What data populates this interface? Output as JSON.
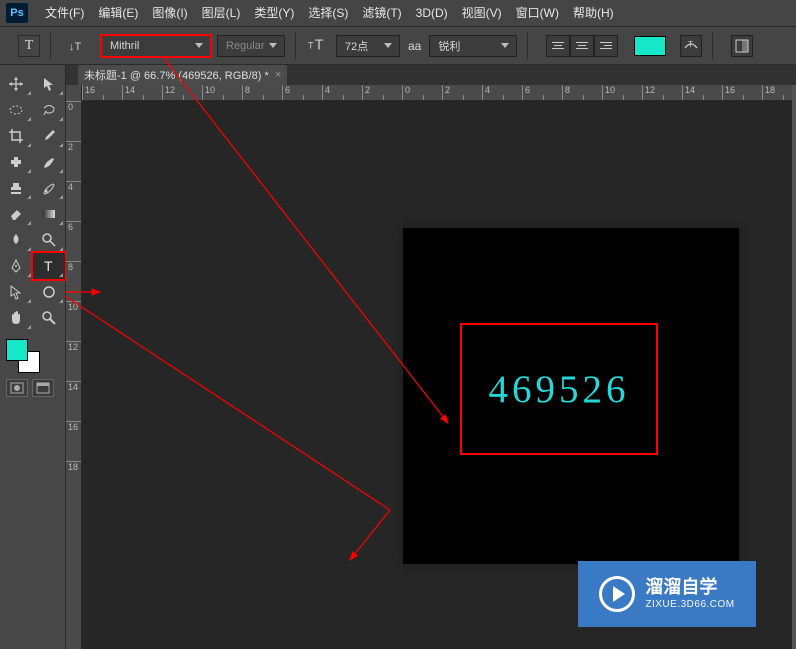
{
  "menu": {
    "items": [
      "文件(F)",
      "编辑(E)",
      "图像(I)",
      "图层(L)",
      "类型(Y)",
      "选择(S)",
      "滤镜(T)",
      "3D(D)",
      "视图(V)",
      "窗口(W)",
      "帮助(H)"
    ]
  },
  "options": {
    "tool_glyph": "T",
    "orient_glyph": "⟀T",
    "font_family": "Mithril",
    "font_style": "Regular",
    "font_size": "72点",
    "aa_label": "aa",
    "aa_mode": "锐利",
    "text_color": "#15e8c8"
  },
  "doc_tab": {
    "title": "未标题-1 @ 66.7% (469526, RGB/8) *",
    "close_glyph": "×"
  },
  "ruler": {
    "h": [
      "16",
      "14",
      "12",
      "10",
      "8",
      "6",
      "4",
      "2",
      "0",
      "2",
      "4",
      "6",
      "8",
      "10",
      "12",
      "14",
      "16",
      "18"
    ],
    "v": [
      "0",
      "2",
      "4",
      "6",
      "8",
      "10",
      "12",
      "14",
      "16",
      "18"
    ]
  },
  "canvas": {
    "sample_text": "469526"
  },
  "swatches": {
    "foreground": "#15e8c8",
    "background": "#ffffff"
  },
  "watermark": {
    "title": "溜溜自学",
    "url": "ZIXUE.3D66.COM"
  }
}
